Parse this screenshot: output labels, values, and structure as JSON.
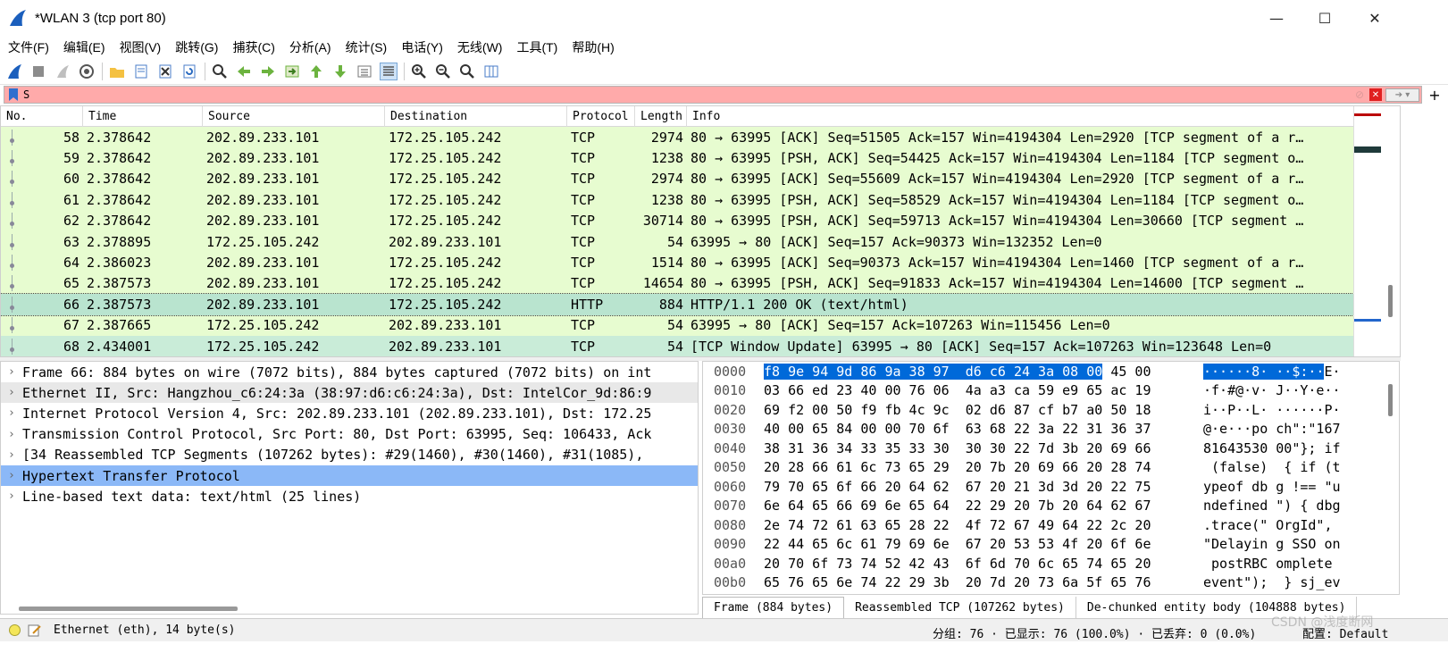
{
  "window": {
    "title": "*WLAN 3 (tcp port 80)",
    "minimize": "—",
    "maximize": "☐",
    "close": "✕"
  },
  "menu": [
    "文件(F)",
    "编辑(E)",
    "视图(V)",
    "跳转(G)",
    "捕获(C)",
    "分析(A)",
    "统计(S)",
    "电话(Y)",
    "无线(W)",
    "工具(T)",
    "帮助(H)"
  ],
  "filter": {
    "value": "S",
    "plus": "+"
  },
  "columns": {
    "no": "No.",
    "time": "Time",
    "source": "Source",
    "destination": "Destination",
    "protocol": "Protocol",
    "length": "Length",
    "info": "Info"
  },
  "packets": [
    {
      "no": "58",
      "time": "2.378642",
      "src": "202.89.233.101",
      "dst": "172.25.105.242",
      "proto": "TCP",
      "len": "2974",
      "info": "80 → 63995 [ACK] Seq=51505 Ack=157 Win=4194304 Len=2920 [TCP segment of a r…"
    },
    {
      "no": "59",
      "time": "2.378642",
      "src": "202.89.233.101",
      "dst": "172.25.105.242",
      "proto": "TCP",
      "len": "1238",
      "info": "80 → 63995 [PSH, ACK] Seq=54425 Ack=157 Win=4194304 Len=1184 [TCP segment o…"
    },
    {
      "no": "60",
      "time": "2.378642",
      "src": "202.89.233.101",
      "dst": "172.25.105.242",
      "proto": "TCP",
      "len": "2974",
      "info": "80 → 63995 [ACK] Seq=55609 Ack=157 Win=4194304 Len=2920 [TCP segment of a r…"
    },
    {
      "no": "61",
      "time": "2.378642",
      "src": "202.89.233.101",
      "dst": "172.25.105.242",
      "proto": "TCP",
      "len": "1238",
      "info": "80 → 63995 [PSH, ACK] Seq=58529 Ack=157 Win=4194304 Len=1184 [TCP segment o…"
    },
    {
      "no": "62",
      "time": "2.378642",
      "src": "202.89.233.101",
      "dst": "172.25.105.242",
      "proto": "TCP",
      "len": "30714",
      "info": "80 → 63995 [PSH, ACK] Seq=59713 Ack=157 Win=4194304 Len=30660 [TCP segment …"
    },
    {
      "no": "63",
      "time": "2.378895",
      "src": "172.25.105.242",
      "dst": "202.89.233.101",
      "proto": "TCP",
      "len": "54",
      "info": "63995 → 80 [ACK] Seq=157 Ack=90373 Win=132352 Len=0"
    },
    {
      "no": "64",
      "time": "2.386023",
      "src": "202.89.233.101",
      "dst": "172.25.105.242",
      "proto": "TCP",
      "len": "1514",
      "info": "80 → 63995 [ACK] Seq=90373 Ack=157 Win=4194304 Len=1460 [TCP segment of a r…"
    },
    {
      "no": "65",
      "time": "2.387573",
      "src": "202.89.233.101",
      "dst": "172.25.105.242",
      "proto": "TCP",
      "len": "14654",
      "info": "80 → 63995 [PSH, ACK] Seq=91833 Ack=157 Win=4194304 Len=14600 [TCP segment …"
    },
    {
      "no": "66",
      "time": "2.387573",
      "src": "202.89.233.101",
      "dst": "172.25.105.242",
      "proto": "HTTP",
      "len": "884",
      "info": "HTTP/1.1 200 OK  (text/html)"
    },
    {
      "no": "67",
      "time": "2.387665",
      "src": "172.25.105.242",
      "dst": "202.89.233.101",
      "proto": "TCP",
      "len": "54",
      "info": "63995 → 80 [ACK] Seq=157 Ack=107263 Win=115456 Len=0"
    },
    {
      "no": "68",
      "time": "2.434001",
      "src": "172.25.105.242",
      "dst": "202.89.233.101",
      "proto": "TCP",
      "len": "54",
      "info": "[TCP Window Update] 63995 → 80 [ACK] Seq=157 Ack=107263 Win=123648 Len=0"
    }
  ],
  "details": [
    "Frame 66: 884 bytes on wire (7072 bits), 884 bytes captured (7072 bits) on int",
    "Ethernet II, Src: Hangzhou_c6:24:3a (38:97:d6:c6:24:3a), Dst: IntelCor_9d:86:9",
    "Internet Protocol Version 4, Src: 202.89.233.101 (202.89.233.101), Dst: 172.25",
    "Transmission Control Protocol, Src Port: 80, Dst Port: 63995, Seq: 106433, Ack",
    "[34 Reassembled TCP Segments (107262 bytes): #29(1460), #30(1460), #31(1085),",
    "Hypertext Transfer Protocol",
    "Line-based text data: text/html (25 lines)"
  ],
  "bytes": [
    {
      "off": "0000",
      "hex_hl": "f8 9e 94 9d 86 9a 38 97  d6 c6 24 3a 08 00",
      "hex": " 45 00",
      "asc_hl": "······8· ··$:··",
      "asc": "E·"
    },
    {
      "off": "0010",
      "hex": "03 66 ed 23 40 00 76 06  4a a3 ca 59 e9 65 ac 19",
      "asc": "·f·#@·v· J··Y·e··"
    },
    {
      "off": "0020",
      "hex": "69 f2 00 50 f9 fb 4c 9c  02 d6 87 cf b7 a0 50 18",
      "asc": "i··P··L· ······P·"
    },
    {
      "off": "0030",
      "hex": "40 00 65 84 00 00 70 6f  63 68 22 3a 22 31 36 37",
      "asc": "@·e···po ch\":\"167"
    },
    {
      "off": "0040",
      "hex": "38 31 36 34 33 35 33 30  30 30 22 7d 3b 20 69 66",
      "asc": "81643530 00\"}; if"
    },
    {
      "off": "0050",
      "hex": "20 28 66 61 6c 73 65 29  20 7b 20 69 66 20 28 74",
      "asc": " (false)  { if (t"
    },
    {
      "off": "0060",
      "hex": "79 70 65 6f 66 20 64 62  67 20 21 3d 3d 20 22 75",
      "asc": "ypeof db g !== \"u"
    },
    {
      "off": "0070",
      "hex": "6e 64 65 66 69 6e 65 64  22 29 20 7b 20 64 62 67",
      "asc": "ndefined \") { dbg"
    },
    {
      "off": "0080",
      "hex": "2e 74 72 61 63 65 28 22  4f 72 67 49 64 22 2c 20",
      "asc": ".trace(\" OrgId\", "
    },
    {
      "off": "0090",
      "hex": "22 44 65 6c 61 79 69 6e  67 20 53 53 4f 20 6f 6e",
      "asc": "\"Delayin g SSO on"
    },
    {
      "off": "00a0",
      "hex": "20 70 6f 73 74 52 42 43  6f 6d 70 6c 65 74 65 20",
      "asc": " postRBC omplete "
    },
    {
      "off": "00b0",
      "hex": "65 76 65 6e 74 22 29 3b  20 7d 20 73 6a 5f 65 76",
      "asc": "event\");  } sj_ev"
    }
  ],
  "byte_tabs": [
    "Frame (884 bytes)",
    "Reassembled TCP (107262 bytes)",
    "De-chunked entity body (104888 bytes)"
  ],
  "status": {
    "text": "Ethernet (eth), 14 byte(s)",
    "stats": "分组: 76 · 已显示: 76 (100.0%) · 已丢弃: 0 (0.0%)",
    "profile": "配置: Default"
  },
  "watermark": "CSDN @浅度断网",
  "colors": {
    "tcp_row": "#e7fcd0",
    "selected_row": "#b9e4cf",
    "filter_bg": "#ffaaaa",
    "detail_selected": "#8bb8f7",
    "byte_highlight": "#0069d9"
  }
}
